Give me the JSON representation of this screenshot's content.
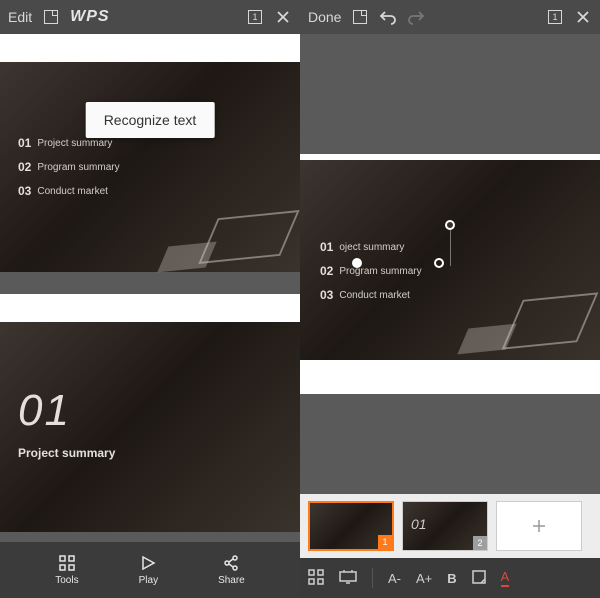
{
  "left": {
    "topbar": {
      "edit": "Edit",
      "logo": "WPS",
      "count": "1"
    },
    "popup": "Recognize text",
    "slideA": {
      "items": [
        {
          "num": "01",
          "txt": "Project summary"
        },
        {
          "num": "02",
          "txt": "Program summary"
        },
        {
          "num": "03",
          "txt": "Conduct market"
        }
      ]
    },
    "slideB": {
      "number": "01",
      "title": "Project summary"
    },
    "actions": {
      "tools": "Tools",
      "play": "Play",
      "share": "Share"
    }
  },
  "right": {
    "topbar": {
      "done": "Done",
      "count": "1"
    },
    "slide": {
      "items": [
        {
          "num": "01",
          "txt": "oject summary"
        },
        {
          "num": "02",
          "txt": "Program summary"
        },
        {
          "num": "03",
          "txt": "Conduct market"
        }
      ]
    },
    "thumbs": {
      "n1": "1",
      "n2": "2",
      "add": "+"
    },
    "toolbar": {
      "aMinus": "A-",
      "aPlus": "A+",
      "bold": "B",
      "fontA": "A"
    }
  }
}
